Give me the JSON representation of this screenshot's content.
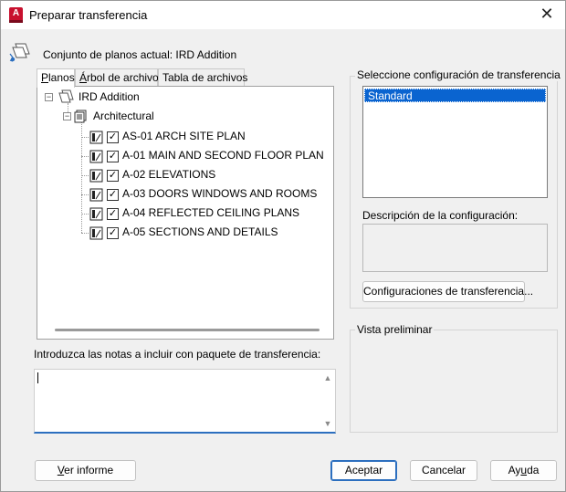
{
  "window": {
    "title": "Preparar transferencia",
    "app_icon_letter": "A",
    "close_glyph": "✕"
  },
  "current_set_label": "Conjunto de planos actual: IRD Addition",
  "tabs": [
    {
      "label_underlined": "P",
      "label_rest": "lanos",
      "active": true
    },
    {
      "label_underlined": "Á",
      "label_rest": "rbol de archivos",
      "active": false
    },
    {
      "label_underlined": "",
      "label_rest": "Tabla de archivos",
      "active": false
    }
  ],
  "tree": {
    "root": "IRD Addition",
    "subset": "Architectural",
    "sheets": [
      {
        "label": "AS-01 ARCH SITE PLAN",
        "checked": true
      },
      {
        "label": "A-01 MAIN AND SECOND FLOOR PLAN",
        "checked": true
      },
      {
        "label": "A-02 ELEVATIONS",
        "checked": true
      },
      {
        "label": "A-03 DOORS WINDOWS AND ROOMS",
        "checked": true
      },
      {
        "label": "A-04 REFLECTED CEILING PLANS",
        "checked": true
      },
      {
        "label": "A-05 SECTIONS AND DETAILS",
        "checked": true
      }
    ]
  },
  "notes": {
    "label": "Introduzca las notas a incluir con paquete de transferencia:",
    "value": ""
  },
  "transfer_config": {
    "group_title": "Seleccione configuración de transferencia",
    "items": [
      "Standard"
    ],
    "selected": "Standard",
    "description_label": "Descripción de la configuración:",
    "description_value": "",
    "configs_button": "Configuraciones de transferencia..."
  },
  "preview": {
    "group_title": "Vista preliminar"
  },
  "footer": {
    "report_button_u": "V",
    "report_button_rest": "er informe",
    "accept_button": "Aceptar",
    "cancel_button": "Cancelar",
    "help_button_pre": "Ay",
    "help_button_u": "u",
    "help_button_post": "da"
  },
  "colors": {
    "accent": "#0a64d0",
    "app_icon": "#c8102e"
  }
}
